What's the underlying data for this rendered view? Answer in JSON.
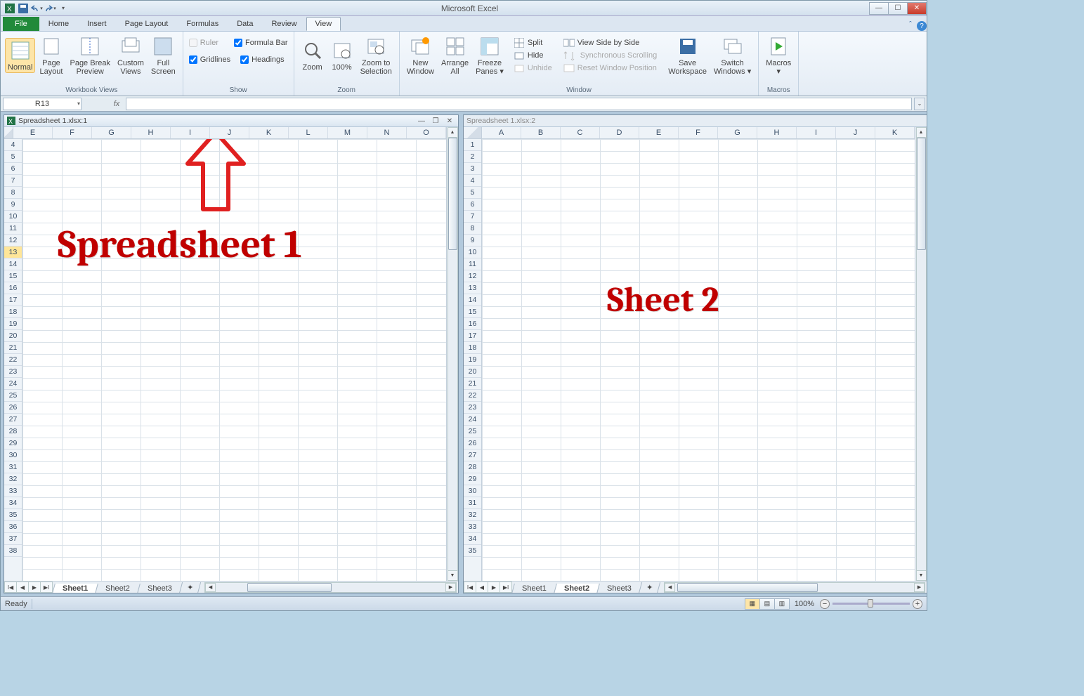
{
  "window": {
    "title": "Microsoft Excel"
  },
  "qat": {
    "items": [
      "excel-icon",
      "save-icon",
      "undo-icon",
      "redo-icon",
      "customize-icon"
    ]
  },
  "ribbon_tabs": [
    "File",
    "Home",
    "Insert",
    "Page Layout",
    "Formulas",
    "Data",
    "Review",
    "View"
  ],
  "ribbon_active_tab": "View",
  "ribbon": {
    "workbook_views": {
      "label": "Workbook Views",
      "normal": "Normal",
      "page_layout": "Page\nLayout",
      "page_break": "Page Break\nPreview",
      "custom_views": "Custom\nViews",
      "full_screen": "Full\nScreen"
    },
    "show": {
      "label": "Show",
      "ruler": "Ruler",
      "formula_bar": "Formula Bar",
      "gridlines": "Gridlines",
      "headings": "Headings"
    },
    "zoom": {
      "label": "Zoom",
      "zoom": "Zoom",
      "hundred": "100%",
      "zoom_selection": "Zoom to\nSelection"
    },
    "window": {
      "label": "Window",
      "new_window": "New\nWindow",
      "arrange_all": "Arrange\nAll",
      "freeze_panes": "Freeze\nPanes",
      "split": "Split",
      "hide": "Hide",
      "unhide": "Unhide",
      "side_by_side": "View Side by Side",
      "sync_scroll": "Synchronous Scrolling",
      "reset_pos": "Reset Window Position",
      "save_workspace": "Save\nWorkspace",
      "switch_windows": "Switch\nWindows"
    },
    "macros": {
      "label": "Macros",
      "macros": "Macros"
    }
  },
  "formula_bar": {
    "namebox": "R13",
    "fx": "fx",
    "value": ""
  },
  "children": {
    "left": {
      "title": "Spreadsheet 1.xlsx:1",
      "columns": [
        "E",
        "F",
        "G",
        "H",
        "I",
        "J",
        "K",
        "L",
        "M",
        "N",
        "O"
      ],
      "row_start": 4,
      "row_end": 38,
      "selected_row": 13,
      "sheets": [
        "Sheet1",
        "Sheet2",
        "Sheet3"
      ],
      "active_sheet": 0
    },
    "right": {
      "title": "Spreadsheet 1.xlsx:2",
      "columns": [
        "A",
        "B",
        "C",
        "D",
        "E",
        "F",
        "G",
        "H",
        "I",
        "J",
        "K"
      ],
      "row_start": 1,
      "row_end": 35,
      "sheets": [
        "Sheet1",
        "Sheet2",
        "Sheet3"
      ],
      "active_sheet": 1
    }
  },
  "status": {
    "ready": "Ready",
    "zoom": "100%"
  },
  "annotations": {
    "left": "Spreadsheet 1",
    "right": "Sheet 2"
  }
}
